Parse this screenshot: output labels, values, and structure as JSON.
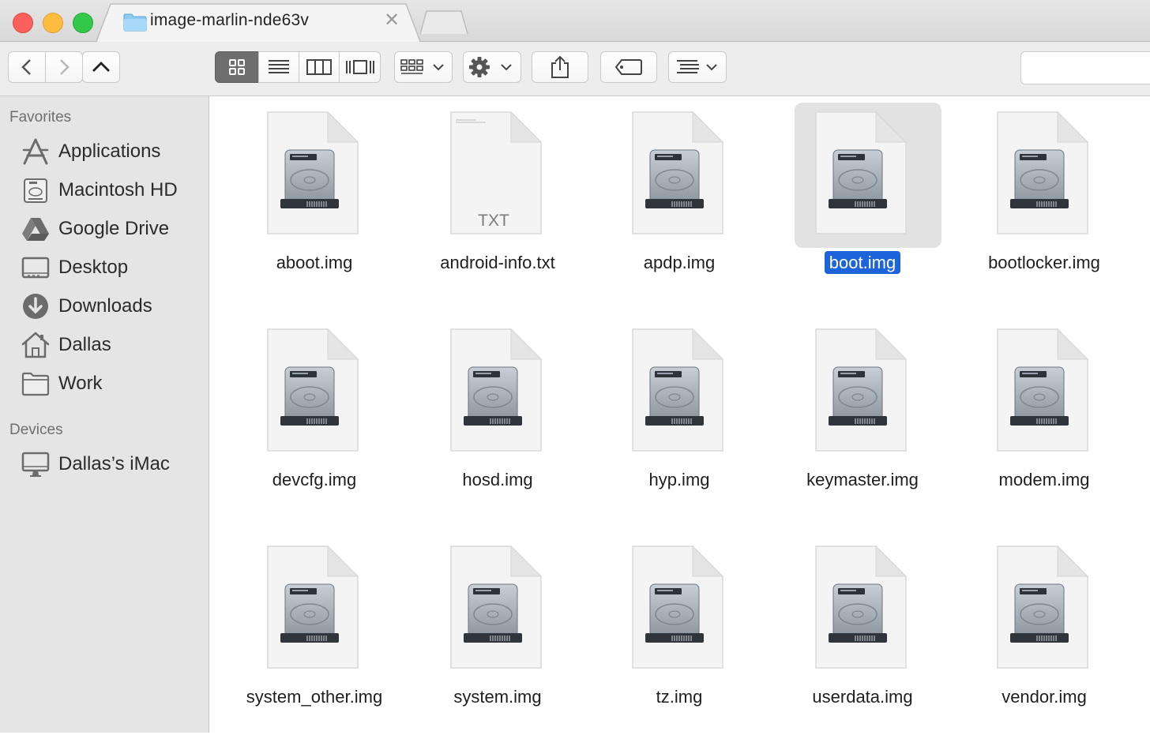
{
  "window": {
    "tab_title": "image-marlin-nde63v",
    "tab_close_glyph": "✕"
  },
  "sidebar": {
    "favorites_header": "Favorites",
    "favorites": [
      {
        "label": "Applications",
        "icon": "applications-icon"
      },
      {
        "label": "Macintosh HD",
        "icon": "hard-drive-icon"
      },
      {
        "label": "Google Drive",
        "icon": "google-drive-icon"
      },
      {
        "label": "Desktop",
        "icon": "desktop-icon"
      },
      {
        "label": "Downloads",
        "icon": "downloads-icon"
      },
      {
        "label": "Dallas",
        "icon": "home-icon"
      },
      {
        "label": "Work",
        "icon": "folder-icon"
      }
    ],
    "devices_header": "Devices",
    "devices": [
      {
        "label": "Dallas’s iMac",
        "icon": "imac-icon"
      }
    ]
  },
  "files": [
    {
      "name": "aboot.img",
      "kind": "disk-image"
    },
    {
      "name": "android-info.txt",
      "kind": "text",
      "badge": "TXT"
    },
    {
      "name": "apdp.img",
      "kind": "disk-image"
    },
    {
      "name": "boot.img",
      "kind": "disk-image",
      "selected": true
    },
    {
      "name": "bootlocker.img",
      "kind": "disk-image"
    },
    {
      "name": "devcfg.img",
      "kind": "disk-image"
    },
    {
      "name": "hosd.img",
      "kind": "disk-image"
    },
    {
      "name": "hyp.img",
      "kind": "disk-image"
    },
    {
      "name": "keymaster.img",
      "kind": "disk-image"
    },
    {
      "name": "modem.img",
      "kind": "disk-image"
    },
    {
      "name": "system_other.img",
      "kind": "disk-image"
    },
    {
      "name": "system.img",
      "kind": "disk-image"
    },
    {
      "name": "tz.img",
      "kind": "disk-image"
    },
    {
      "name": "userdata.img",
      "kind": "disk-image"
    },
    {
      "name": "vendor.img",
      "kind": "disk-image"
    }
  ],
  "colors": {
    "selection": "#1d63d9",
    "close": "#fc605c",
    "minimize": "#fdbc40",
    "maximize": "#34c84a"
  }
}
